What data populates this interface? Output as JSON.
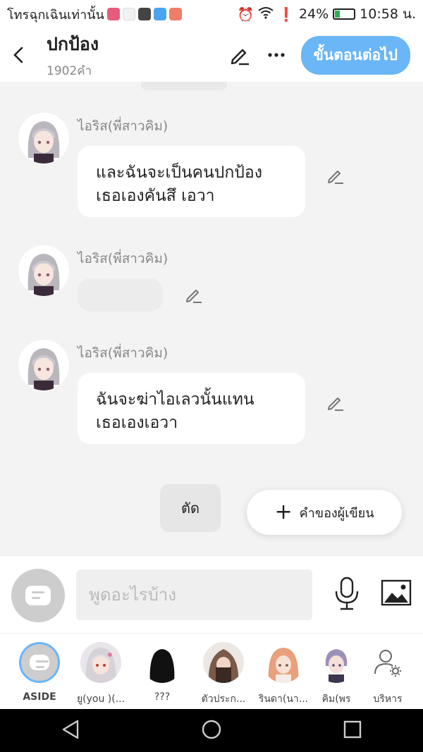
{
  "status_bar": {
    "carrier_text": "โทรฉุกเฉินเท่านั้น",
    "battery_percent": "24%",
    "time": "10:58 น.",
    "battery_level": 0.24
  },
  "header": {
    "title": "ปกป้อง",
    "word_count": "1902คำ",
    "next_label": "ขั้นตอนต่อไป"
  },
  "messages": [
    {
      "name": "ไอริส(พี่สาวคิม)",
      "line1": "และฉันจะเป็นคนปกป้อง",
      "line2": "เธอเองคันสึ เอวา"
    },
    {
      "name": "ไอริส(พี่สาวคิม)",
      "line1": "",
      "line2": ""
    },
    {
      "name": "ไอริส(พี่สาวคิม)",
      "line1": "ฉันจะฆ่าไอเลวนั้นแทน",
      "line2": "เธอเองเอวา"
    }
  ],
  "actions": {
    "cut_label": "ตัด",
    "writer_note_label": "คำของผู้เขียน"
  },
  "input": {
    "placeholder": "พูดอะไรบ้าง"
  },
  "characters": [
    {
      "label": "ASIDE"
    },
    {
      "label": "ยู(you )(..."
    },
    {
      "label": "???"
    },
    {
      "label": "ตัวประก..."
    },
    {
      "label": "รินดา(นา..."
    },
    {
      "label": "คิม(พร"
    },
    {
      "label": "บริหาร"
    }
  ],
  "colors": {
    "accent": "#6ab6f6",
    "bubble": "#ffffff",
    "background": "#f3f3f3"
  }
}
